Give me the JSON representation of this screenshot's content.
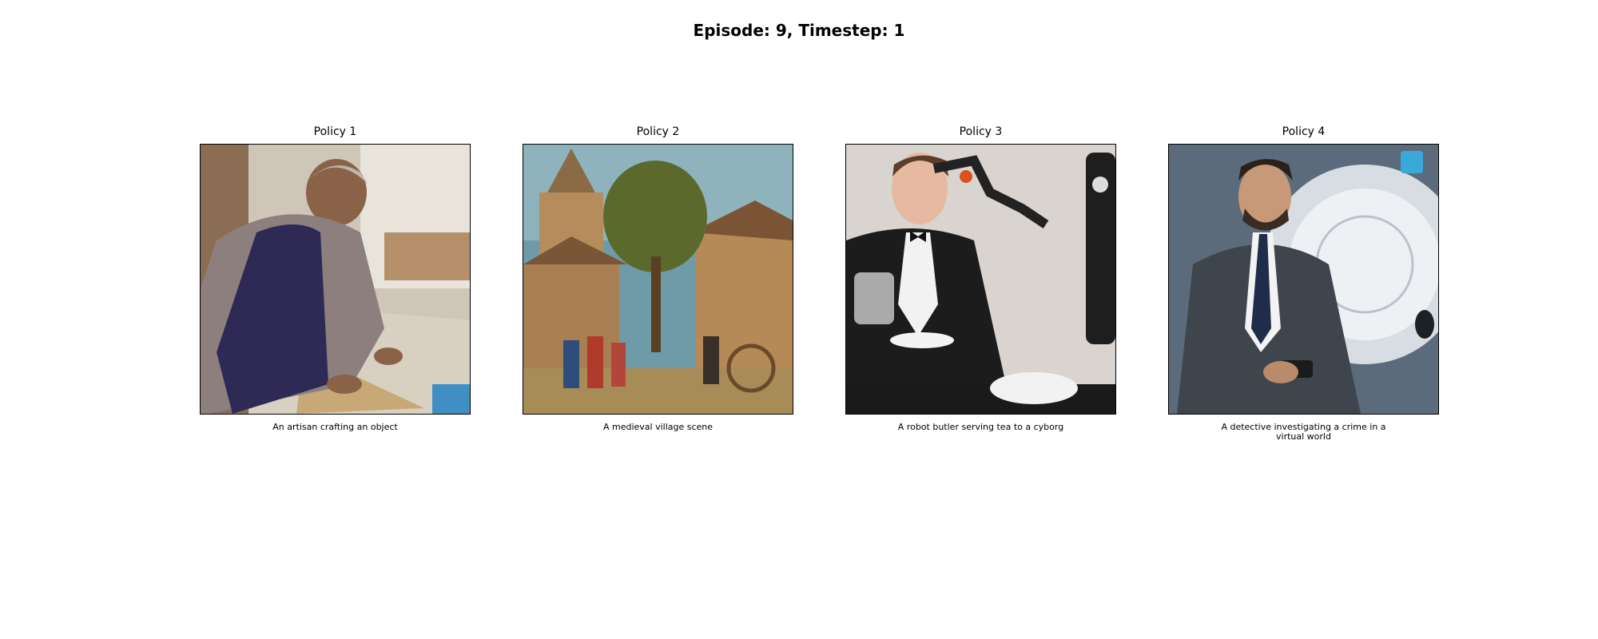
{
  "title": "Episode: 9, Timestep: 1",
  "panels": [
    {
      "title": "Policy 1",
      "caption": "An artisan crafting an object",
      "image": "artisan crafting at workbench photo"
    },
    {
      "title": "Policy 2",
      "caption": "A medieval village scene",
      "image": "medieval village painting"
    },
    {
      "title": "Policy 3",
      "caption": "A robot butler serving tea to a cyborg",
      "image": "butler with robotic arm photo"
    },
    {
      "title": "Policy 4",
      "caption": "A detective investigating a crime in a virtual world",
      "image": "detective in suit with holographic interface"
    }
  ]
}
